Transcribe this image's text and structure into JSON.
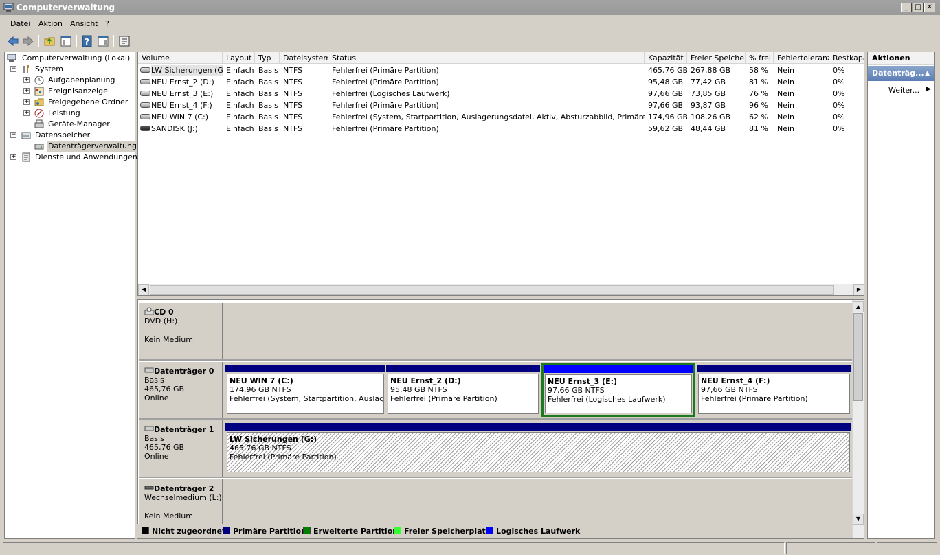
{
  "window": {
    "title": "Computerverwaltung",
    "minimize": "_",
    "maximize": "□",
    "close": "✕"
  },
  "menu": [
    "Datei",
    "Aktion",
    "Ansicht",
    "?"
  ],
  "toolbar": [
    "back-icon",
    "forward-icon",
    "up-folder-icon",
    "show-hide-tree-icon",
    "help-icon",
    "show-hide-action-pane-icon",
    "properties-icon"
  ],
  "tree": {
    "root": "Computerverwaltung (Lokal)",
    "system": "System",
    "aufgaben": "Aufgabenplanung",
    "ereignis": "Ereignisanzeige",
    "freigegeben": "Freigegebene Ordner",
    "leistung": "Leistung",
    "geraete": "Geräte-Manager",
    "datenspeicher": "Datenspeicher",
    "datentraeger": "Datenträgerverwaltung",
    "dienste": "Dienste und Anwendungen"
  },
  "list": {
    "headers": [
      "Volume",
      "Layout",
      "Typ",
      "Dateisystem",
      "Status",
      "Kapazität",
      "Freier Speicher",
      "% frei",
      "Fehlertoleranz",
      "Restkapa"
    ],
    "rows": [
      [
        "LW Sicherungen (G:)",
        "Einfach",
        "Basis",
        "NTFS",
        "Fehlerfrei (Primäre Partition)",
        "465,76 GB",
        "267,88 GB",
        "58 %",
        "Nein",
        "0%"
      ],
      [
        "NEU Ernst_2 (D:)",
        "Einfach",
        "Basis",
        "NTFS",
        "Fehlerfrei (Primäre Partition)",
        "95,48 GB",
        "77,42 GB",
        "81 %",
        "Nein",
        "0%"
      ],
      [
        "NEU Ernst_3 (E:)",
        "Einfach",
        "Basis",
        "NTFS",
        "Fehlerfrei (Logisches Laufwerk)",
        "97,66 GB",
        "73,85 GB",
        "76 %",
        "Nein",
        "0%"
      ],
      [
        "NEU Ernst_4 (F:)",
        "Einfach",
        "Basis",
        "NTFS",
        "Fehlerfrei (Primäre Partition)",
        "97,66 GB",
        "93,87 GB",
        "96 %",
        "Nein",
        "0%"
      ],
      [
        "NEU WIN 7 (C:)",
        "Einfach",
        "Basis",
        "NTFS",
        "Fehlerfrei (System, Startpartition, Auslagerungsdatei, Aktiv, Absturzabbild, Primäre Partition)",
        "174,96 GB",
        "108,26 GB",
        "62 %",
        "Nein",
        "0%"
      ],
      [
        "SANDISK (J:)",
        "Einfach",
        "Basis",
        "NTFS",
        "Fehlerfrei (Primäre Partition)",
        "59,62 GB",
        "48,44 GB",
        "81 %",
        "Nein",
        "0%"
      ]
    ]
  },
  "disks": {
    "cd0": {
      "name": "CD 0",
      "line1": "DVD (H:)",
      "line2": "",
      "line3": "Kein Medium"
    },
    "d0": {
      "name": "Datenträger 0",
      "line1": "Basis",
      "line2": "465,76 GB",
      "line3": "Online",
      "parts": [
        {
          "title": "NEU WIN 7  (C:)",
          "size": "174,96 GB NTFS",
          "status": "Fehlerfrei (System, Startpartition, Auslagerun"
        },
        {
          "title": "NEU Ernst_2  (D:)",
          "size": "95,48 GB NTFS",
          "status": "Fehlerfrei (Primäre Partition)"
        },
        {
          "title": "NEU Ernst_3  (E:)",
          "size": "97,66 GB NTFS",
          "status": "Fehlerfrei (Logisches Laufwerk)"
        },
        {
          "title": "NEU Ernst_4  (F:)",
          "size": "97,66 GB NTFS",
          "status": "Fehlerfrei (Primäre Partition)"
        }
      ]
    },
    "d1": {
      "name": "Datenträger 1",
      "line1": "Basis",
      "line2": "465,76 GB",
      "line3": "Online",
      "parts": [
        {
          "title": "LW Sicherungen  (G:)",
          "size": "465,76 GB NTFS",
          "status": "Fehlerfrei (Primäre Partition)"
        }
      ]
    },
    "d2": {
      "name": "Datenträger 2",
      "line1": "Wechselmedium (L:)",
      "line2": "",
      "line3": "Kein Medium"
    }
  },
  "legend": [
    "Nicht zugeordnet",
    "Primäre Partition",
    "Erweiterte Partition",
    "Freier Speicherplatz",
    "Logisches Laufwerk"
  ],
  "colors": {
    "nicht_zugeordnet": "#000000",
    "primaer": "#000080",
    "erweitert": "#008000",
    "frei": "#33ff33",
    "logisch": "#0000ff",
    "selected_border": "#1e7a1e"
  },
  "actions": {
    "header": "Aktionen",
    "sub": "Datenträg...",
    "more": "Weiter..."
  }
}
